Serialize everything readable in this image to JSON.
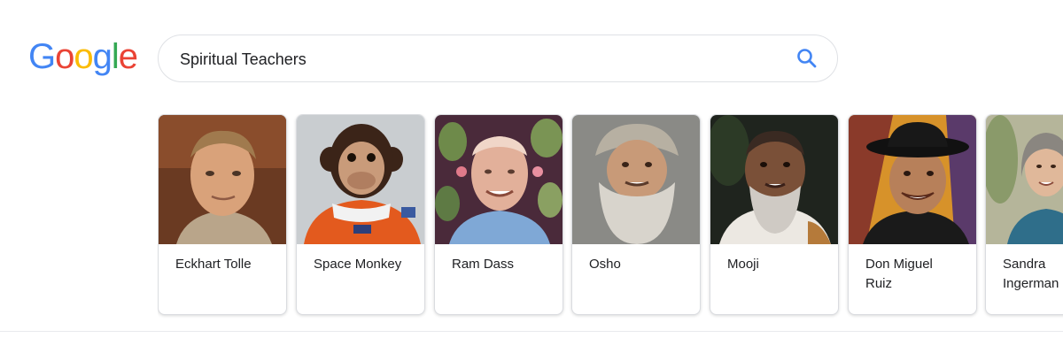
{
  "logo": {
    "letters": [
      "G",
      "o",
      "o",
      "g",
      "l",
      "e"
    ],
    "colors": [
      "#4285F4",
      "#EA4335",
      "#FBBC05",
      "#4285F4",
      "#34A853",
      "#EA4335"
    ]
  },
  "search": {
    "value": "Spiritual Teachers",
    "icon": "search-icon",
    "icon_color": "#4285F4"
  },
  "carousel": {
    "cards": [
      {
        "name_line1": "Eckhart Tolle",
        "name_line2": "",
        "photo": "portrait-man-blond"
      },
      {
        "name_line1": "Space Monkey",
        "name_line2": "",
        "photo": "chimp-in-spacesuit"
      },
      {
        "name_line1": "Ram Dass",
        "name_line2": "",
        "photo": "portrait-bald-man-floral-bg"
      },
      {
        "name_line1": "Osho",
        "name_line2": "",
        "photo": "portrait-bearded-man-cap"
      },
      {
        "name_line1": "Mooji",
        "name_line2": "",
        "photo": "portrait-bearded-man-dark-bg"
      },
      {
        "name_line1": "Don Miguel",
        "name_line2": "Ruiz",
        "photo": "portrait-man-black-hat"
      },
      {
        "name_line1": "Sandra",
        "name_line2": "Ingerman",
        "photo": "portrait-woman-grey-hair"
      }
    ]
  }
}
